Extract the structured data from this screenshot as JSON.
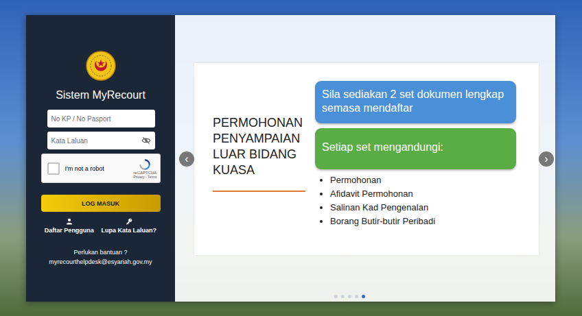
{
  "app": {
    "title": "Sistem MyRecourt"
  },
  "login": {
    "fields": [
      {
        "placeholder": "No KP / No Pasport",
        "kind": "text"
      },
      {
        "placeholder": "Kata Laluan",
        "kind": "password"
      }
    ],
    "captcha": {
      "label": "I'm not a robot",
      "checked": false,
      "brand": "reCAPTCHA",
      "links": "Privacy - Terms"
    },
    "submit": "LOG MASUK",
    "links": [
      {
        "label": "Daftar Pengguna",
        "kind": "register"
      },
      {
        "label": "Lupa Kata Laluan?",
        "kind": "reset"
      }
    ],
    "help": {
      "text": "Perlukan bantuan ?",
      "email": "myrecourthelpdesk@esyariah.gov.my"
    }
  },
  "carousel": {
    "prev": "‹",
    "next": "›",
    "slide": {
      "title": "PERMOHONAN PENYAMPAIAN LUAR BIDANG KUASA",
      "notice": "Sila sediakan 2 set dokumen lengkap semasa mendaftar",
      "heading": "Setiap set mengandungi:",
      "items": [
        "Permohonan",
        "Afidavit Permohonan",
        "Salinan Kad Pengenalan",
        "Borang Butir-butir Peribadi"
      ]
    },
    "dots": [
      {
        "selected": false
      },
      {
        "selected": false
      },
      {
        "selected": false
      },
      {
        "selected": false
      },
      {
        "selected": true
      }
    ]
  }
}
